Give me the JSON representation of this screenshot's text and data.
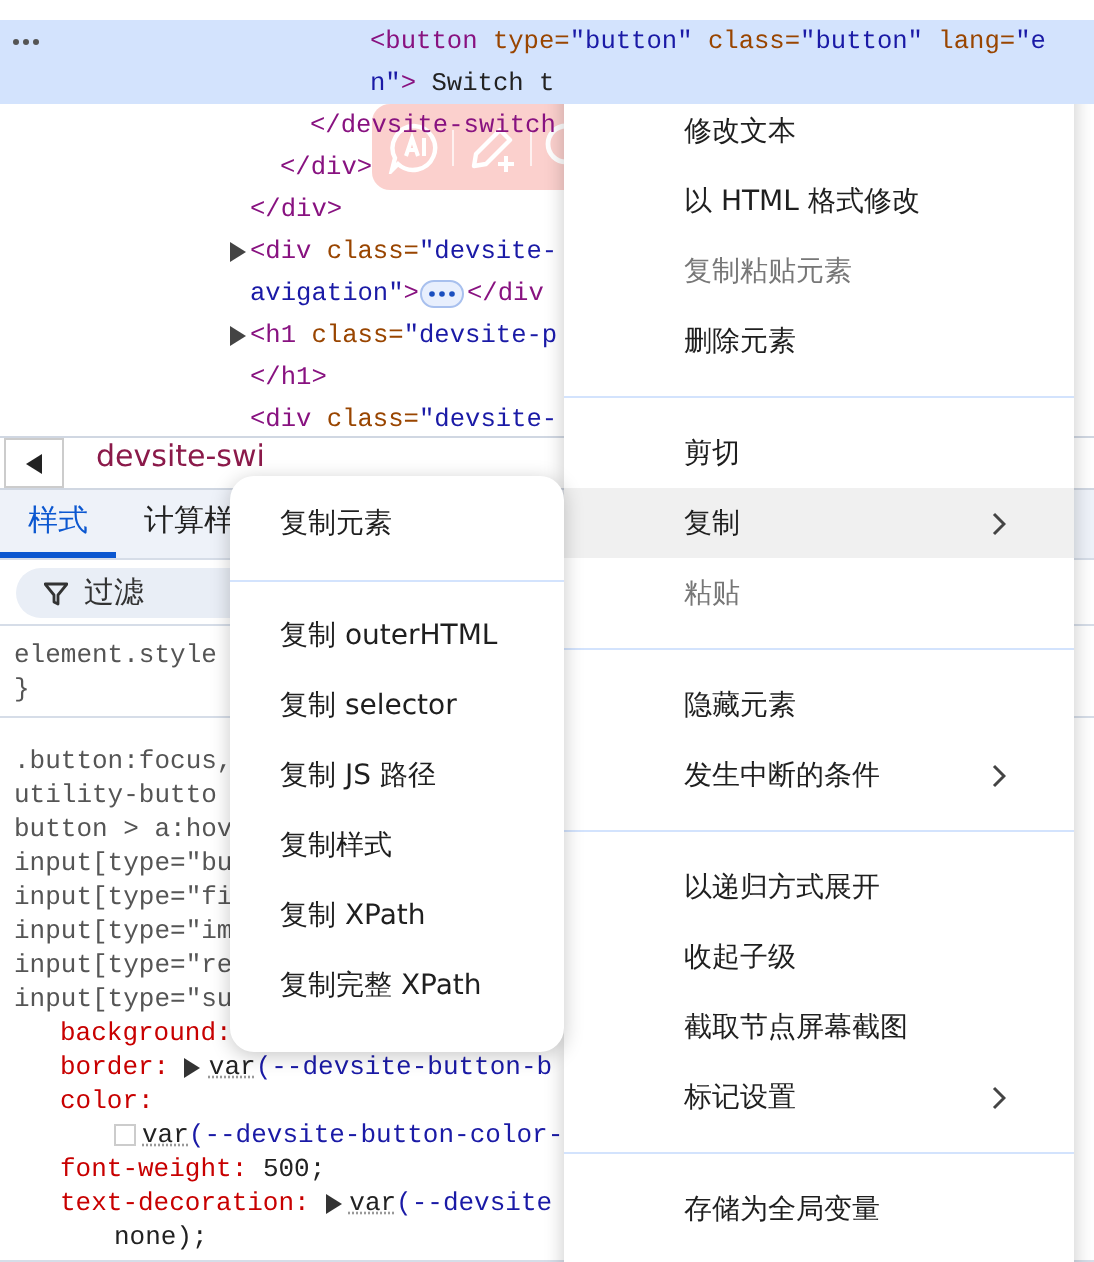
{
  "elements_panel": {
    "nodes": [
      {
        "children": [
          {
            "children": [
              {
                "children": [
                  {
                    "children": [
                      {
                        "selected": true,
                        "expandable": false,
                        "open": [
                          [
                            {
                              "kind": "tag",
                              "text": "<button"
                            },
                            {
                              "kind": "attr",
                              "text": " type="
                            },
                            {
                              "kind": "value",
                              "text": "\"button\""
                            },
                            {
                              "kind": "attr",
                              "text": " class="
                            },
                            {
                              "kind": "value",
                              "text": "\"button\""
                            },
                            {
                              "kind": "attr",
                              "text": " lang="
                            },
                            {
                              "kind": "value",
                              "text": "\"e"
                            }
                          ],
                          [
                            {
                              "kind": "value",
                              "text": "n\""
                            },
                            {
                              "kind": "tag",
                              "text": ">"
                            },
                            {
                              "kind": "text",
                              "text": " Switch t"
                            }
                          ]
                        ]
                      }
                    ]
                  }
                ],
                "close": [
                  [
                    {
                      "kind": "tag",
                      "text": "</devsite-switch"
                    }
                  ]
                ]
              }
            ],
            "close": [
              [
                {
                  "kind": "tag",
                  "text": "</div>"
                }
              ]
            ]
          }
        ],
        "close": [
          [
            {
              "kind": "tag",
              "text": "</div>"
            }
          ]
        ]
      },
      {
        "selected": false,
        "expandable": true,
        "open": [
          [
            {
              "kind": "tag",
              "text": "<div"
            },
            {
              "kind": "attr",
              "text": " class="
            },
            {
              "kind": "value",
              "text": "\"devsite-"
            }
          ],
          [
            {
              "kind": "value",
              "text": "avigation\""
            },
            {
              "kind": "tag",
              "text": ">"
            },
            {
              "kind": "collapsed"
            },
            {
              "kind": "tag",
              "text": "</div"
            }
          ]
        ]
      },
      {
        "selected": false,
        "expandable": true,
        "open": [
          [
            {
              "kind": "tag",
              "text": "<h1"
            },
            {
              "kind": "attr",
              "text": " class="
            },
            {
              "kind": "value",
              "text": "\"devsite-p"
            }
          ]
        ],
        "close": [
          [
            {
              "kind": "tag",
              "text": "</h1>"
            }
          ]
        ]
      },
      {
        "selected": false,
        "expandable": false,
        "open": [
          [
            {
              "kind": "tag",
              "text": "<div"
            },
            {
              "kind": "attr",
              "text": " class="
            },
            {
              "kind": "value",
              "text": "\"devsite-"
            }
          ]
        ]
      }
    ]
  },
  "breadcrumb": {
    "text": "devsite-swi"
  },
  "tabs": [
    {
      "label": "样式",
      "selected": true
    },
    {
      "label": "计算样",
      "selected": false
    }
  ],
  "filter": {
    "placeholder": "过滤"
  },
  "styles": {
    "rules": [
      {
        "selector_lines": [
          "element.style"
        ],
        "close": "}"
      },
      {
        "selector_lines": [
          ".button:focus,",
          "utility-butto",
          "button > a:hov",
          "input[type=\"bu",
          "input[type=\"fi",
          "input[type=\"im",
          "input[type=\"re",
          "input[type=\"su"
        ],
        "declarations": [
          {
            "property": "background:"
          },
          {
            "property": "border:",
            "value": [
              {
                "kind": "expand"
              },
              {
                "kind": "var",
                "text": "var"
              },
              {
                "kind": "ref",
                "text": "(--devsite-button-b"
              }
            ]
          },
          {
            "property": "color:",
            "continuation": [
              [
                {
                  "kind": "swatch"
                },
                {
                  "kind": "var",
                  "text": "var"
                },
                {
                  "kind": "ref",
                  "text": "(--devsite-button-color-"
                }
              ]
            ]
          },
          {
            "property": "font-weight:",
            "value": [
              {
                "kind": "plain",
                "text": "500;"
              }
            ]
          },
          {
            "property": "text-decoration:",
            "value": [
              {
                "kind": "expand"
              },
              {
                "kind": "var",
                "text": "var"
              },
              {
                "kind": "ref",
                "text": "(--devsite"
              }
            ],
            "continuation": [
              [
                {
                  "kind": "plain",
                  "text": "none);"
                }
              ]
            ]
          }
        ]
      }
    ]
  },
  "context_menu": {
    "items": [
      {
        "kind": "item",
        "label": "修改文本",
        "disabled": false,
        "submenu": false,
        "selected": false
      },
      {
        "kind": "item",
        "label": "以 HTML 格式修改",
        "disabled": false,
        "submenu": false,
        "selected": false
      },
      {
        "kind": "item",
        "label": "复制粘贴元素",
        "disabled": true,
        "submenu": false,
        "selected": false
      },
      {
        "kind": "item",
        "label": "删除元素",
        "disabled": false,
        "submenu": false,
        "selected": false
      },
      {
        "kind": "separator"
      },
      {
        "kind": "item",
        "label": "剪切",
        "disabled": false,
        "submenu": false,
        "selected": false
      },
      {
        "kind": "item",
        "label": "复制",
        "disabled": false,
        "submenu": true,
        "selected": true
      },
      {
        "kind": "item",
        "label": "粘贴",
        "disabled": true,
        "submenu": false,
        "selected": false
      },
      {
        "kind": "separator"
      },
      {
        "kind": "item",
        "label": "隐藏元素",
        "disabled": false,
        "submenu": false,
        "selected": false
      },
      {
        "kind": "item",
        "label": "发生中断的条件",
        "disabled": false,
        "submenu": true,
        "selected": false
      },
      {
        "kind": "separator"
      },
      {
        "kind": "item",
        "label": "以递归方式展开",
        "disabled": false,
        "submenu": false,
        "selected": false
      },
      {
        "kind": "item",
        "label": "收起子级",
        "disabled": false,
        "submenu": false,
        "selected": false
      },
      {
        "kind": "item",
        "label": "截取节点屏幕截图",
        "disabled": false,
        "submenu": false,
        "selected": false
      },
      {
        "kind": "item",
        "label": "标记设置",
        "disabled": false,
        "submenu": true,
        "selected": false
      },
      {
        "kind": "separator"
      },
      {
        "kind": "item",
        "label": "存储为全局变量",
        "disabled": false,
        "submenu": false,
        "selected": false
      }
    ]
  },
  "submenu": {
    "items": [
      {
        "kind": "item",
        "label": "复制元素",
        "disabled": false,
        "selected": false
      },
      {
        "kind": "separator"
      },
      {
        "kind": "item",
        "label": "复制 outerHTML",
        "disabled": false,
        "selected": false
      },
      {
        "kind": "item",
        "label": "复制 selector",
        "disabled": false,
        "selected": false
      },
      {
        "kind": "item",
        "label": "复制 JS 路径",
        "disabled": false,
        "selected": false
      },
      {
        "kind": "item",
        "label": "复制样式",
        "disabled": false,
        "selected": false
      },
      {
        "kind": "item",
        "label": "复制 XPath",
        "disabled": false,
        "selected": false
      },
      {
        "kind": "item",
        "label": "复制完整 XPath",
        "disabled": false,
        "selected": false
      }
    ]
  }
}
